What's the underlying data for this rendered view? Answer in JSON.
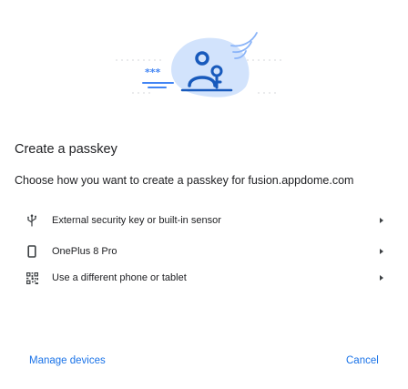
{
  "dialog": {
    "title": "Create a passkey",
    "subtitle": "Choose how you want to create a passkey for fusion.appdome.com",
    "illustration_stars": "***"
  },
  "options": [
    {
      "label": "External security key or built-in sensor",
      "icon": "usb-icon"
    },
    {
      "label": "OnePlus 8 Pro",
      "icon": "phone-icon"
    },
    {
      "label": "Use a different phone or tablet",
      "icon": "qr-code-icon"
    }
  ],
  "footer": {
    "manage_label": "Manage devices",
    "cancel_label": "Cancel"
  },
  "colors": {
    "accent": "#1a73e8",
    "illustration_blob": "#d2e3fc",
    "illustration_dark": "#185abc"
  }
}
